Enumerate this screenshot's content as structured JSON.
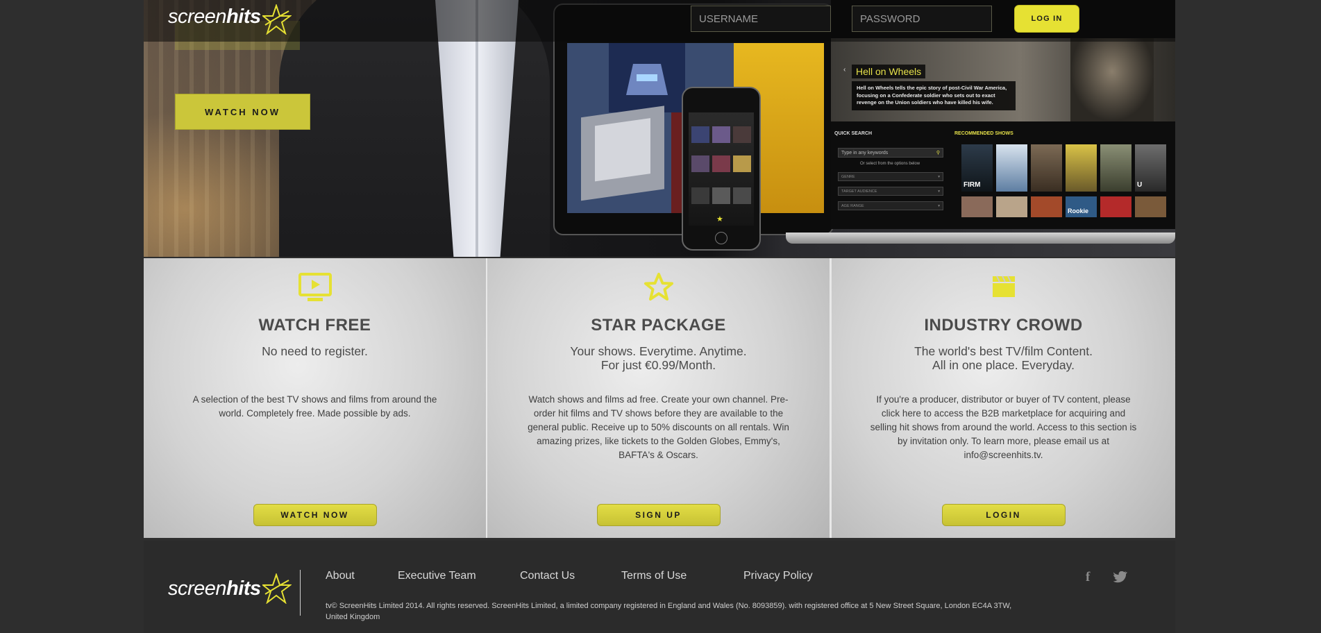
{
  "brand": {
    "logo_part1": "screen",
    "logo_part2": "hits",
    "accent_color": "#e6e133"
  },
  "header": {
    "username_placeholder": "USERNAME",
    "password_placeholder": "PASSWORD",
    "login_label": "LOG IN"
  },
  "hero": {
    "watch_now_label": "WATCH NOW",
    "showcase": {
      "title": "Hell on Wheels",
      "description": "Hell on Wheels tells the epic story of post-Civil War America, focusing on a Confederate soldier who sets out to exact revenge on the Union soldiers who have killed his wife.",
      "quick_search_label": "QUICK SEARCH",
      "search_placeholder": "Type in any keywords",
      "or_select_note": "Or select from the options below",
      "filters": [
        "GENRE",
        "TARGET AUDIENCE",
        "AGE RANGE"
      ],
      "recommended_label": "RECOMMENDED SHOWS",
      "posters": [
        "FIRM",
        "",
        "",
        "",
        "",
        "U"
      ],
      "posters_row2": [
        "",
        "",
        "",
        "Rookie",
        "",
        ""
      ]
    }
  },
  "features": [
    {
      "icon": "tv-play-icon",
      "title": "WATCH FREE",
      "subtitle": "No need to register.",
      "body": "A selection of the best TV shows and films from around the world. Completely free. Made possible by ads.",
      "button": "WATCH NOW"
    },
    {
      "icon": "star-icon",
      "title": "STAR PACKAGE",
      "subtitle_line1": "Your shows. Everytime. Anytime.",
      "subtitle_line2": "For just €0.99/Month.",
      "body": "Watch shows and films ad free. Create your own channel. Pre-order hit films and TV shows before they are available to the general public. Receive up to 50% discounts on all rentals. Win amazing prizes, like tickets to the Golden Globes, Emmy's, BAFTA's & Oscars.",
      "button": "SIGN UP"
    },
    {
      "icon": "clapperboard-icon",
      "title": "INDUSTRY CROWD",
      "subtitle_line1": "The world's best TV/film Content.",
      "subtitle_line2": "All in one place. Everyday.",
      "body": "If you're a producer, distributor or buyer of TV content, please click here to access the B2B marketplace for acquiring and selling hit shows from around the world. Access to this section is by invitation only. To learn more, please email us at info@screenhits.tv.",
      "button": "LOGIN"
    }
  ],
  "footer": {
    "links": [
      "About",
      "Executive Team",
      "Contact Us",
      "Terms of Use",
      "Privacy Policy"
    ],
    "copyright": "tv© ScreenHits Limited 2014. All rights reserved. ScreenHits Limited, a limited company registered in England and Wales (No. 8093859). with registered office at 5 New Street Square, London EC4A 3TW, United Kingdom",
    "social": {
      "facebook": "f",
      "twitter": "twitter-bird"
    }
  }
}
